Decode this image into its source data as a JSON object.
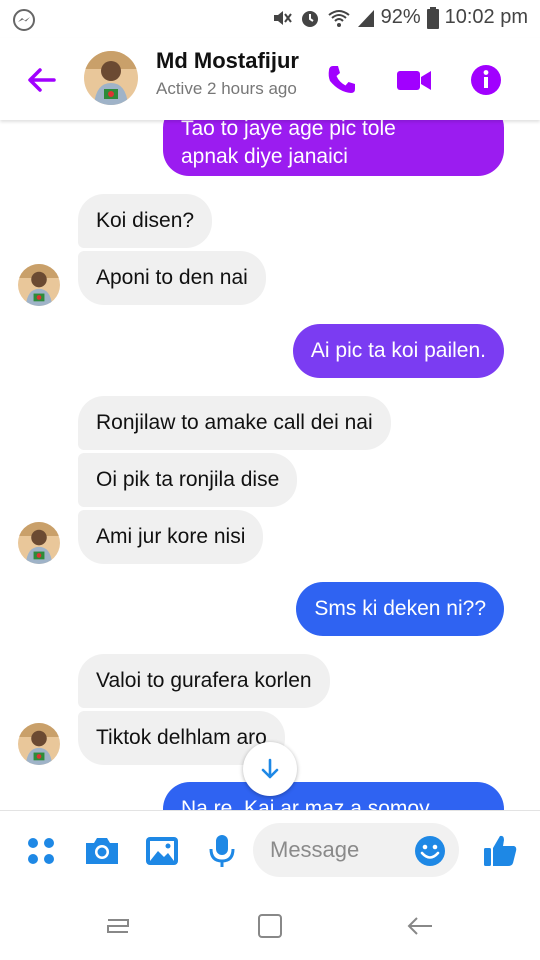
{
  "status_bar": {
    "battery_percent": "92%",
    "time": "10:02 pm"
  },
  "header": {
    "contact_name": "Md Mostafijur",
    "contact_status": "Active 2 hours ago"
  },
  "messages": [
    {
      "direction": "outgoing",
      "lines": [
        "Tao to jaye age pic tole",
        "apnak diye janaici"
      ]
    },
    {
      "direction": "incoming",
      "text": "Koi disen?"
    },
    {
      "direction": "incoming",
      "text": "Aponi to den nai"
    },
    {
      "direction": "outgoing",
      "text": "Ai pic ta koi pailen."
    },
    {
      "direction": "incoming",
      "text": "Ronjilaw to amake call dei nai"
    },
    {
      "direction": "incoming",
      "text": "Oi pik ta ronjila dise"
    },
    {
      "direction": "incoming",
      "text": "Ami jur kore nisi"
    },
    {
      "direction": "outgoing",
      "text": "Sms ki deken ni??"
    },
    {
      "direction": "incoming",
      "text": "Valoi to gurafera korlen"
    },
    {
      "direction": "incoming",
      "text": "Tiktok delhlam aro"
    },
    {
      "direction": "outgoing",
      "text": "Na re. Kai ar maz a somoy"
    }
  ],
  "composer": {
    "placeholder": "Message"
  },
  "colors": {
    "accent": "#a100ff",
    "purple_bubble": "#9b1cf0",
    "violet_bubble": "#7b3cf2",
    "blue_bubble": "#2f63f2",
    "composer_icon": "#1e88e5"
  },
  "icons": [
    "messenger-icon",
    "mute-icon",
    "alarm-icon",
    "wifi-icon",
    "signal-icon",
    "battery-icon",
    "back-arrow-icon",
    "phone-icon",
    "video-icon",
    "info-icon",
    "arrow-down-icon",
    "apps-icon",
    "camera-icon",
    "gallery-icon",
    "mic-icon",
    "emoji-icon",
    "like-icon",
    "recents-icon",
    "home-icon",
    "back-icon"
  ]
}
